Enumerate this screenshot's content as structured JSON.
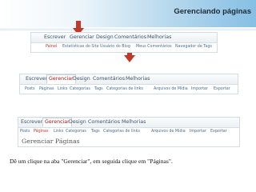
{
  "header": {
    "title": "Gerenciando páginas"
  },
  "panel1": {
    "menu": [
      "Escrever",
      "Gerenciar",
      "Design",
      "Comentários",
      "Melhorias"
    ],
    "submenu": [
      "Painel",
      "Estatísticas do Site",
      "Usuário do Blog",
      "Meus Comentários",
      "Navegador de Tags"
    ]
  },
  "panel2": {
    "menu": [
      "Escrever",
      "Gerenciar",
      "Design",
      "Comentários",
      "Melhorias"
    ],
    "submenu": [
      "Posts",
      "Páginas",
      "Links",
      "Categorias",
      "Tags",
      "Categorias de links",
      "Arquivos de Mídia",
      "Importar",
      "Exportar"
    ]
  },
  "panel3": {
    "menu": [
      "Escrever",
      "Gerenciar",
      "Design",
      "Comentários",
      "Melhorias"
    ],
    "submenu": [
      "Posts",
      "Páginas",
      "Links",
      "Categorias",
      "Tags",
      "Categorias de links",
      "Arquivos de Mídia",
      "Importar",
      "Exportar"
    ],
    "heading": "Gerenciar Páginas"
  },
  "caption": "Dê um clique na aba \"Gerenciar\", em seguida clique em \"Páginas\".",
  "colors": {
    "arrow": "#c0392b",
    "link": "#4a6e91",
    "active": "#c23b2a"
  }
}
